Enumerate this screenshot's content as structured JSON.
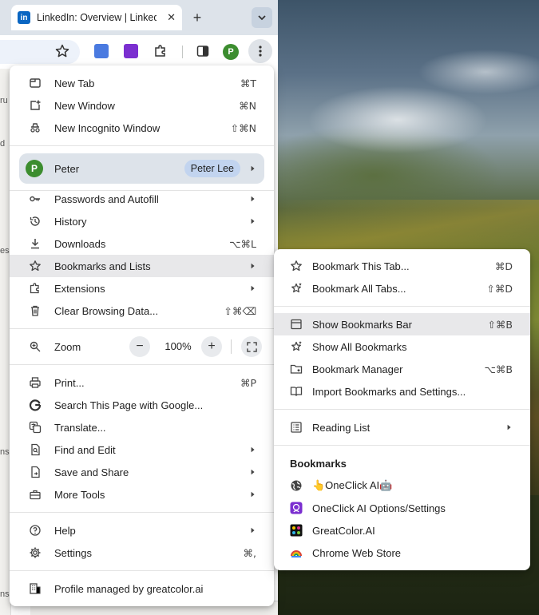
{
  "window": {
    "tab_title": "LinkedIn: Overview | LinkedIn",
    "tab_favicon_text": "in",
    "new_tab_glyph": "+",
    "tab_close_glyph": "✕",
    "tab_search_glyph": "⌄",
    "profile_initial": "P"
  },
  "page_edge_text": [
    "ru",
    "d",
    "es",
    "ns",
    "ns"
  ],
  "main_menu": {
    "items": [
      {
        "label": "New Tab",
        "shortcut": "⌘T",
        "icon": "new-tab-icon"
      },
      {
        "label": "New Window",
        "shortcut": "⌘N",
        "icon": "new-window-icon"
      },
      {
        "label": "New Incognito Window",
        "shortcut": "⇧⌘N",
        "icon": "incognito-icon"
      }
    ],
    "profile": {
      "initial": "P",
      "name": "Peter",
      "account": "Peter Lee"
    },
    "group2": [
      {
        "label": "Passwords and Autofill",
        "icon": "key-icon",
        "submenu": true
      },
      {
        "label": "History",
        "icon": "history-icon",
        "submenu": true
      },
      {
        "label": "Downloads",
        "shortcut": "⌥⌘L",
        "icon": "download-icon"
      },
      {
        "label": "Bookmarks and Lists",
        "icon": "star-icon",
        "submenu": true,
        "highlighted": true
      },
      {
        "label": "Extensions",
        "icon": "puzzle-icon",
        "submenu": true
      },
      {
        "label": "Clear Browsing Data...",
        "shortcut": "⇧⌘⌫",
        "icon": "trash-icon"
      }
    ],
    "zoom": {
      "label": "Zoom",
      "value": "100%",
      "minus": "−",
      "plus": "+"
    },
    "group3": [
      {
        "label": "Print...",
        "shortcut": "⌘P",
        "icon": "print-icon"
      },
      {
        "label": "Search This Page with Google...",
        "icon": "google-icon"
      },
      {
        "label": "Translate...",
        "icon": "translate-icon"
      },
      {
        "label": "Find and Edit",
        "icon": "find-icon",
        "submenu": true
      },
      {
        "label": "Save and Share",
        "icon": "share-icon",
        "submenu": true
      },
      {
        "label": "More Tools",
        "icon": "toolbox-icon",
        "submenu": true
      }
    ],
    "group4": [
      {
        "label": "Help",
        "icon": "help-icon",
        "submenu": true
      },
      {
        "label": "Settings",
        "shortcut": "⌘,",
        "icon": "settings-icon"
      }
    ],
    "managed": {
      "label": "Profile managed by greatcolor.ai",
      "icon": "building-icon"
    }
  },
  "bookmarks_menu": {
    "group1": [
      {
        "label": "Bookmark This Tab...",
        "shortcut": "⌘D",
        "icon": "star-outline-icon"
      },
      {
        "label": "Bookmark All Tabs...",
        "shortcut": "⇧⌘D",
        "icon": "stars-icon"
      }
    ],
    "group2": [
      {
        "label": "Show Bookmarks Bar",
        "shortcut": "⇧⌘B",
        "icon": "bookmarks-bar-icon",
        "highlighted": true
      },
      {
        "label": "Show All Bookmarks",
        "icon": "stars-icon"
      },
      {
        "label": "Bookmark Manager",
        "shortcut": "⌥⌘B",
        "icon": "bookmark-manager-icon"
      },
      {
        "label": "Import Bookmarks and Settings...",
        "icon": "import-icon"
      }
    ],
    "reading_list": {
      "label": "Reading List",
      "icon": "reading-list-icon",
      "submenu": true
    },
    "bookmarks_heading": "Bookmarks",
    "bookmarks": [
      {
        "label": "👆OneClick AI🤖",
        "icon": "globe-icon"
      },
      {
        "label": "OneClick AI Options/Settings",
        "icon": "oneclick-favicon-icon"
      },
      {
        "label": "GreatColor.AI",
        "icon": "greatcolor-favicon-icon"
      },
      {
        "label": "Chrome Web Store",
        "icon": "chrome-web-store-icon"
      }
    ]
  },
  "colors": {
    "highlight": "#e8e8ea",
    "profile_green": "#3c8d2f",
    "profile_row_bg": "#dde3ea",
    "account_pill": "#c2d4ef",
    "linkedin_blue": "#0a66c2",
    "oneclick_purple": "#7b2fd0"
  }
}
